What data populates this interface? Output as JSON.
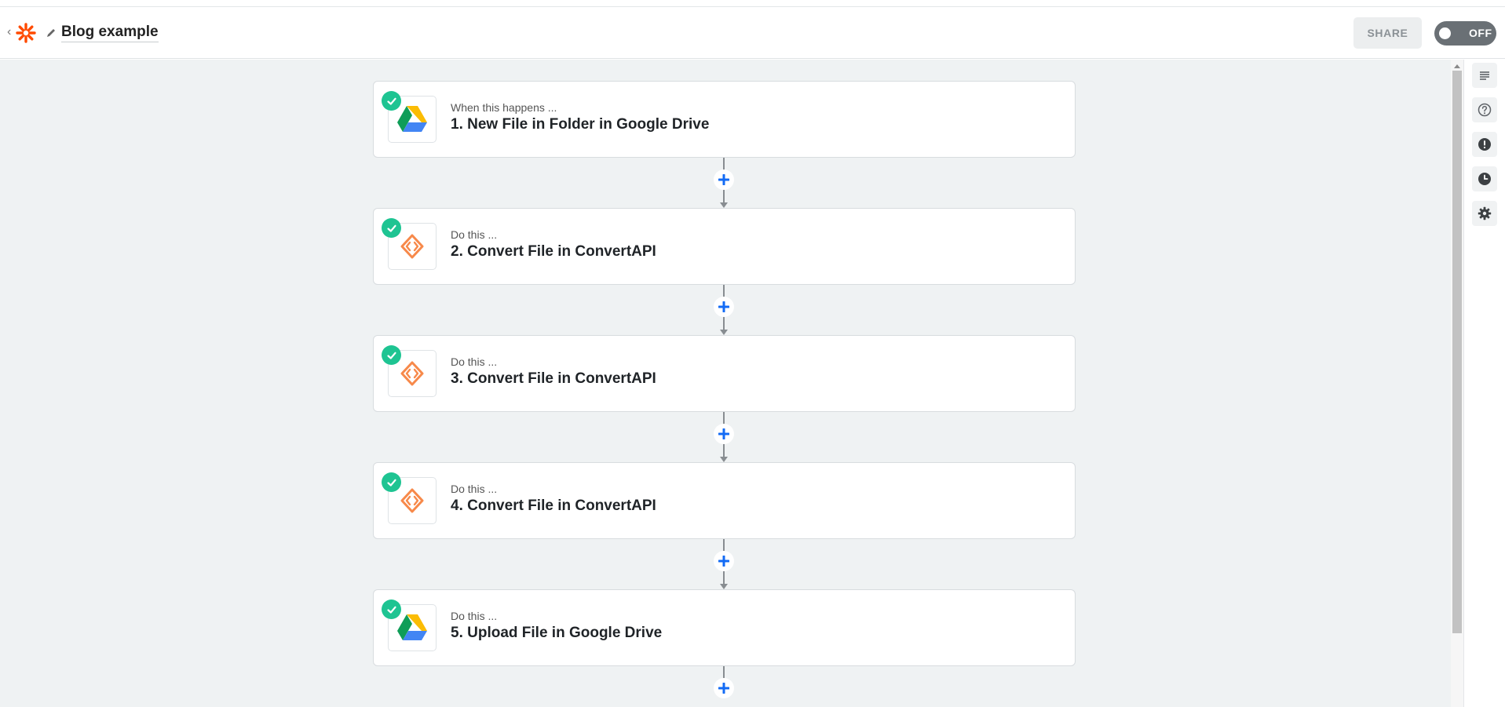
{
  "header": {
    "title": "Blog example",
    "share_label": "SHARE",
    "toggle_label": "OFF"
  },
  "steps": [
    {
      "kicker": "When this happens ...",
      "title": "1. New File in Folder in Google Drive",
      "app": "google-drive"
    },
    {
      "kicker": "Do this ...",
      "title": "2. Convert File in ConvertAPI",
      "app": "convertapi"
    },
    {
      "kicker": "Do this ...",
      "title": "3. Convert File in ConvertAPI",
      "app": "convertapi"
    },
    {
      "kicker": "Do this ...",
      "title": "4. Convert File in ConvertAPI",
      "app": "convertapi"
    },
    {
      "kicker": "Do this ...",
      "title": "5. Upload File in Google Drive",
      "app": "google-drive"
    }
  ],
  "right_rail": [
    "details-icon",
    "help-icon",
    "alert-icon",
    "history-icon",
    "settings-icon"
  ],
  "colors": {
    "brand_orange": "#ff4a00",
    "check_green": "#1ec492",
    "add_blue": "#136bf5",
    "convertapi_orange": "#f7894a"
  }
}
